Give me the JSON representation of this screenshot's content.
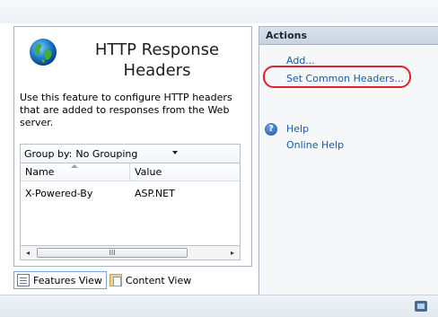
{
  "page": {
    "title": "HTTP Response Headers",
    "description": "Use this feature to configure HTTP headers that are added to responses from the Web server."
  },
  "group_by": {
    "label": "Group by:",
    "value": "No Grouping"
  },
  "grid": {
    "columns": [
      "Name",
      "Value"
    ],
    "rows": [
      {
        "name": "X-Powered-By",
        "value": "ASP.NET"
      }
    ]
  },
  "scrollbar": {
    "left_arrow": "◂",
    "right_arrow": "▸",
    "thumb_grip": "III"
  },
  "views": {
    "features": "Features View",
    "content": "Content View"
  },
  "actions": {
    "header": "Actions",
    "items": [
      "Add...",
      "Set Common Headers...",
      "Help",
      "Online Help"
    ]
  },
  "icons": {
    "help": "?"
  },
  "colors": {
    "link": "#1a5aa6",
    "highlight": "#e0202a"
  }
}
